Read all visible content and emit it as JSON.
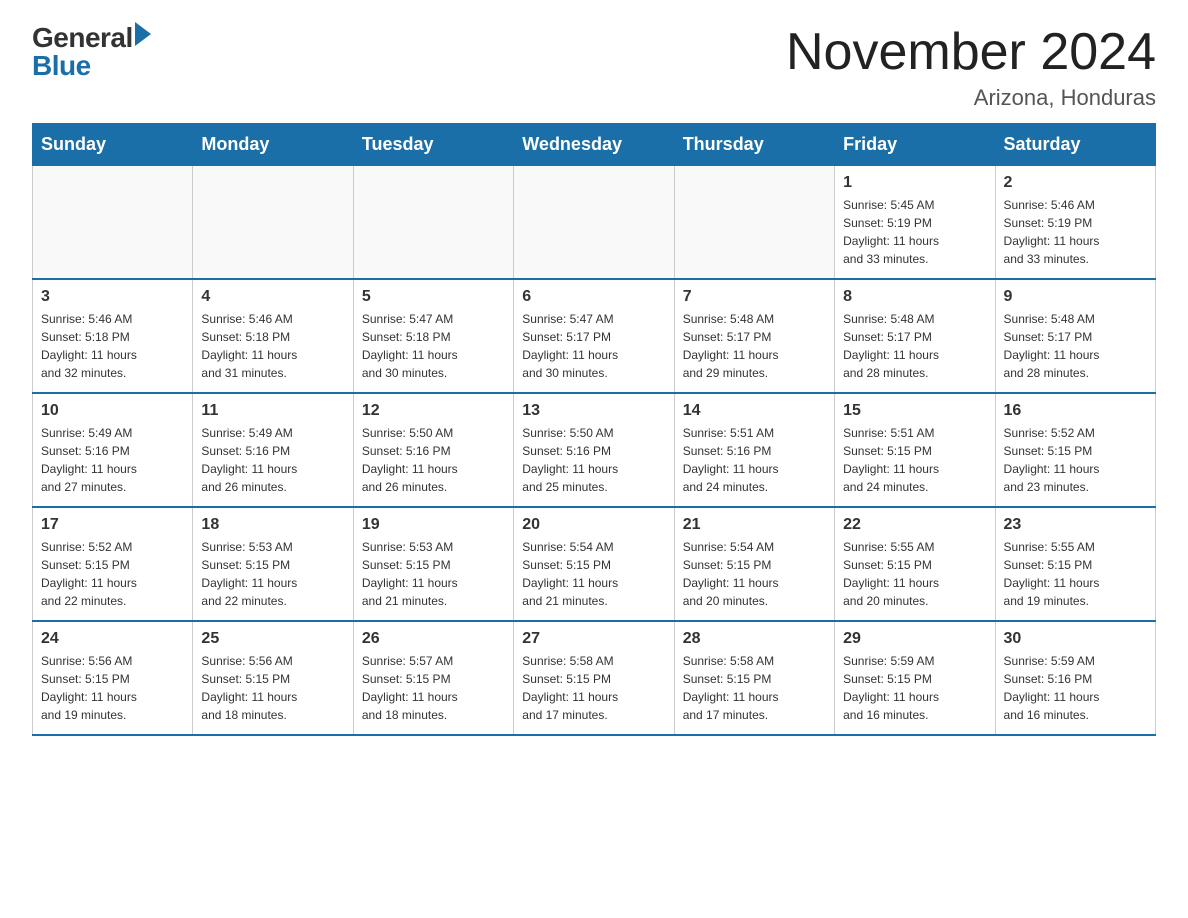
{
  "logo": {
    "general": "General",
    "blue": "Blue"
  },
  "title": "November 2024",
  "subtitle": "Arizona, Honduras",
  "days_header": [
    "Sunday",
    "Monday",
    "Tuesday",
    "Wednesday",
    "Thursday",
    "Friday",
    "Saturday"
  ],
  "weeks": [
    [
      {
        "day": "",
        "info": ""
      },
      {
        "day": "",
        "info": ""
      },
      {
        "day": "",
        "info": ""
      },
      {
        "day": "",
        "info": ""
      },
      {
        "day": "",
        "info": ""
      },
      {
        "day": "1",
        "info": "Sunrise: 5:45 AM\nSunset: 5:19 PM\nDaylight: 11 hours\nand 33 minutes."
      },
      {
        "day": "2",
        "info": "Sunrise: 5:46 AM\nSunset: 5:19 PM\nDaylight: 11 hours\nand 33 minutes."
      }
    ],
    [
      {
        "day": "3",
        "info": "Sunrise: 5:46 AM\nSunset: 5:18 PM\nDaylight: 11 hours\nand 32 minutes."
      },
      {
        "day": "4",
        "info": "Sunrise: 5:46 AM\nSunset: 5:18 PM\nDaylight: 11 hours\nand 31 minutes."
      },
      {
        "day": "5",
        "info": "Sunrise: 5:47 AM\nSunset: 5:18 PM\nDaylight: 11 hours\nand 30 minutes."
      },
      {
        "day": "6",
        "info": "Sunrise: 5:47 AM\nSunset: 5:17 PM\nDaylight: 11 hours\nand 30 minutes."
      },
      {
        "day": "7",
        "info": "Sunrise: 5:48 AM\nSunset: 5:17 PM\nDaylight: 11 hours\nand 29 minutes."
      },
      {
        "day": "8",
        "info": "Sunrise: 5:48 AM\nSunset: 5:17 PM\nDaylight: 11 hours\nand 28 minutes."
      },
      {
        "day": "9",
        "info": "Sunrise: 5:48 AM\nSunset: 5:17 PM\nDaylight: 11 hours\nand 28 minutes."
      }
    ],
    [
      {
        "day": "10",
        "info": "Sunrise: 5:49 AM\nSunset: 5:16 PM\nDaylight: 11 hours\nand 27 minutes."
      },
      {
        "day": "11",
        "info": "Sunrise: 5:49 AM\nSunset: 5:16 PM\nDaylight: 11 hours\nand 26 minutes."
      },
      {
        "day": "12",
        "info": "Sunrise: 5:50 AM\nSunset: 5:16 PM\nDaylight: 11 hours\nand 26 minutes."
      },
      {
        "day": "13",
        "info": "Sunrise: 5:50 AM\nSunset: 5:16 PM\nDaylight: 11 hours\nand 25 minutes."
      },
      {
        "day": "14",
        "info": "Sunrise: 5:51 AM\nSunset: 5:16 PM\nDaylight: 11 hours\nand 24 minutes."
      },
      {
        "day": "15",
        "info": "Sunrise: 5:51 AM\nSunset: 5:15 PM\nDaylight: 11 hours\nand 24 minutes."
      },
      {
        "day": "16",
        "info": "Sunrise: 5:52 AM\nSunset: 5:15 PM\nDaylight: 11 hours\nand 23 minutes."
      }
    ],
    [
      {
        "day": "17",
        "info": "Sunrise: 5:52 AM\nSunset: 5:15 PM\nDaylight: 11 hours\nand 22 minutes."
      },
      {
        "day": "18",
        "info": "Sunrise: 5:53 AM\nSunset: 5:15 PM\nDaylight: 11 hours\nand 22 minutes."
      },
      {
        "day": "19",
        "info": "Sunrise: 5:53 AM\nSunset: 5:15 PM\nDaylight: 11 hours\nand 21 minutes."
      },
      {
        "day": "20",
        "info": "Sunrise: 5:54 AM\nSunset: 5:15 PM\nDaylight: 11 hours\nand 21 minutes."
      },
      {
        "day": "21",
        "info": "Sunrise: 5:54 AM\nSunset: 5:15 PM\nDaylight: 11 hours\nand 20 minutes."
      },
      {
        "day": "22",
        "info": "Sunrise: 5:55 AM\nSunset: 5:15 PM\nDaylight: 11 hours\nand 20 minutes."
      },
      {
        "day": "23",
        "info": "Sunrise: 5:55 AM\nSunset: 5:15 PM\nDaylight: 11 hours\nand 19 minutes."
      }
    ],
    [
      {
        "day": "24",
        "info": "Sunrise: 5:56 AM\nSunset: 5:15 PM\nDaylight: 11 hours\nand 19 minutes."
      },
      {
        "day": "25",
        "info": "Sunrise: 5:56 AM\nSunset: 5:15 PM\nDaylight: 11 hours\nand 18 minutes."
      },
      {
        "day": "26",
        "info": "Sunrise: 5:57 AM\nSunset: 5:15 PM\nDaylight: 11 hours\nand 18 minutes."
      },
      {
        "day": "27",
        "info": "Sunrise: 5:58 AM\nSunset: 5:15 PM\nDaylight: 11 hours\nand 17 minutes."
      },
      {
        "day": "28",
        "info": "Sunrise: 5:58 AM\nSunset: 5:15 PM\nDaylight: 11 hours\nand 17 minutes."
      },
      {
        "day": "29",
        "info": "Sunrise: 5:59 AM\nSunset: 5:15 PM\nDaylight: 11 hours\nand 16 minutes."
      },
      {
        "day": "30",
        "info": "Sunrise: 5:59 AM\nSunset: 5:16 PM\nDaylight: 11 hours\nand 16 minutes."
      }
    ]
  ]
}
